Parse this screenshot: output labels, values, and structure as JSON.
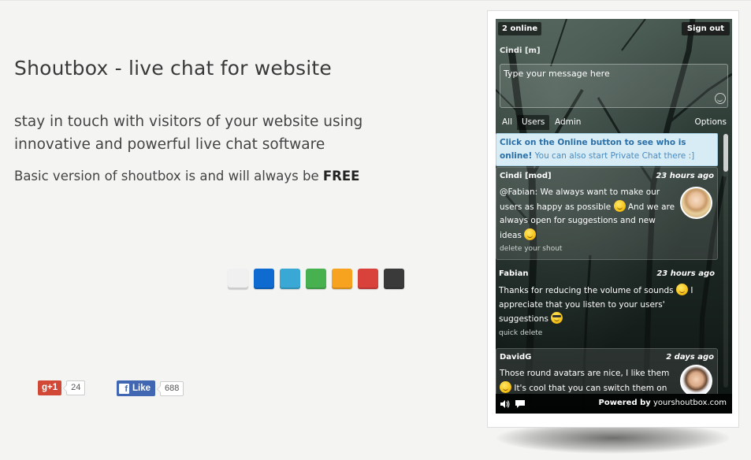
{
  "page": {
    "title": "Shoutbox - live chat for website",
    "description": "stay in touch with visitors of your website using innovative and powerful live chat software",
    "free_prefix": "Basic version of shoutbox is and will always be",
    "free_word": "FREE"
  },
  "theme_colors": [
    "#f0f0f0",
    "#0f6bd0",
    "#3aa8d4",
    "#48b14f",
    "#f7a31f",
    "#d9413b",
    "#3a3a3a"
  ],
  "social": {
    "gplus_label": "g+1",
    "gplus_count": "24",
    "fb_label": "Like",
    "fb_count": "688"
  },
  "widget": {
    "online": "2 online",
    "signout": "Sign out",
    "username": "Cindi [m]",
    "message_placeholder": "Type your message here",
    "tabs": [
      "All",
      "Users",
      "Admin"
    ],
    "options": "Options",
    "notice_bold": "Click on the Online button to see who is online!",
    "notice_rest": "You can also start Private Chat there :]",
    "shouts": [
      {
        "author": "Cindi [mod]",
        "time": "23 hours ago",
        "text_a": "@Fabian: We always want to make our users as happy as possible",
        "text_b": "And we are always open for suggestions and new ideas",
        "action": "delete your shout",
        "avatar": "female-avatar"
      },
      {
        "author": "Fabian",
        "time": "23 hours ago",
        "text_a": "Thanks for reducing the volume of sounds",
        "text_b": "I appreciate that you listen to your users' suggestions",
        "action": "quick delete"
      },
      {
        "author": "DavidG",
        "time": "2 days ago",
        "text_a": "Those round avatars are nice, I like them",
        "text_b": "It's cool that you can switch them on",
        "avatar": "male-avatar"
      }
    ],
    "footer_powered": "Powered by",
    "footer_link": "yourshoutbox.com"
  }
}
